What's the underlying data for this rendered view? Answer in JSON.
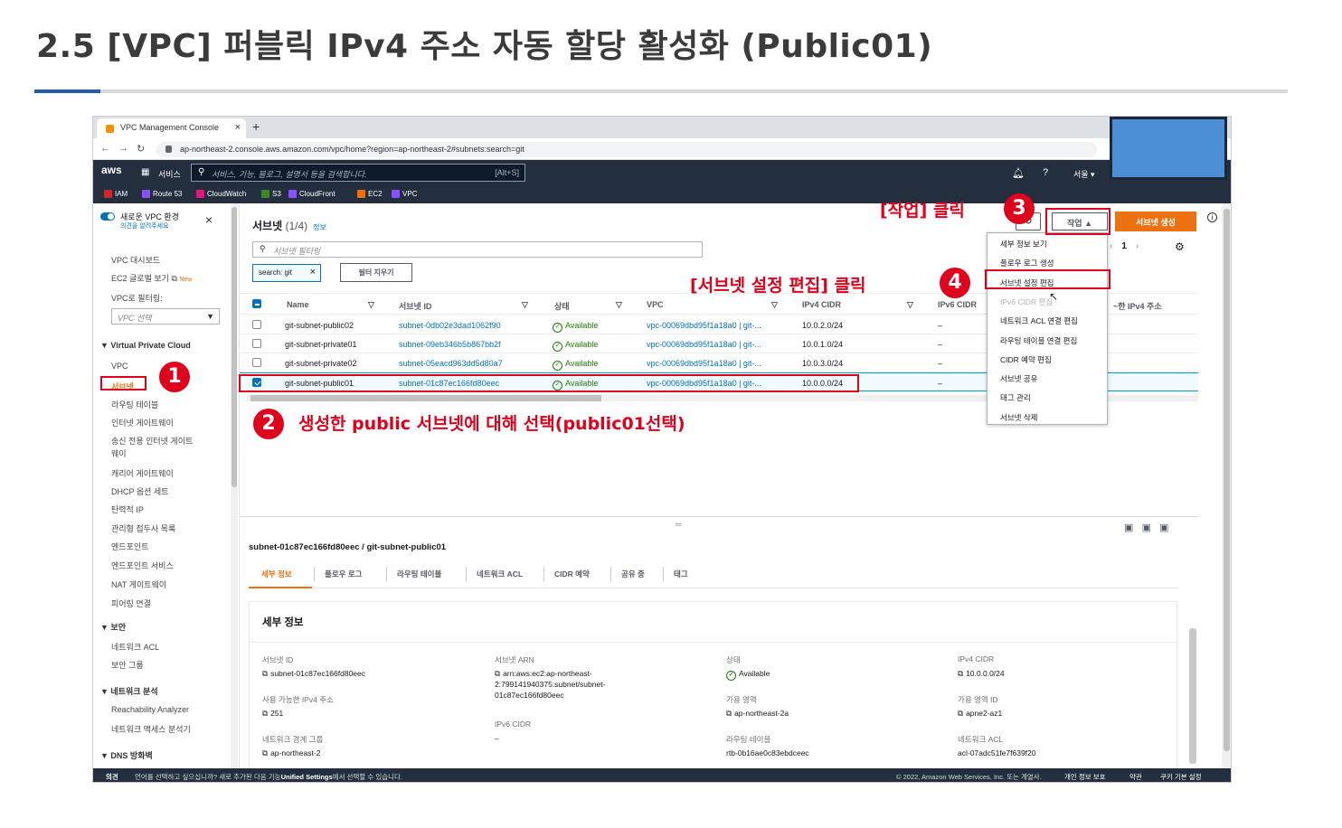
{
  "slide": {
    "title": "2.5 [VPC] 퍼블릭 IPv4 주소 자동 할당 활성화 (Public01)"
  },
  "browser": {
    "tab_title": "VPC Management Console",
    "url": "ap-northeast-2.console.aws.amazon.com/vpc/home?region=ap-northeast-2#subnets:search=git"
  },
  "awsbar": {
    "logo": "aws",
    "services": "서비스",
    "search_placeholder": "서비스, 기능, 블로그, 설명서 등을 검색합니다.",
    "search_shortcut": "[Alt+S]",
    "region": "서울 ▾",
    "bookmarks": [
      {
        "label": "IAM",
        "color": "#d6242d"
      },
      {
        "label": "Route 53",
        "color": "#8c4fff"
      },
      {
        "label": "CloudWatch",
        "color": "#e7157b"
      },
      {
        "label": "S3",
        "color": "#3f8624"
      },
      {
        "label": "CloudFront",
        "color": "#8c4fff"
      },
      {
        "label": "EC2",
        "color": "#ed7100"
      },
      {
        "label": "VPC",
        "color": "#8c4fff"
      }
    ]
  },
  "sidebar": {
    "new_vpc": "새로운 VPC 환경",
    "feedback": "의견을 알려주세요",
    "dashboard": "VPC 대시보드",
    "ec2_global": "EC2 글로벌 보기",
    "new_badge": "New",
    "filter_label": "VPC로 필터링:",
    "vpc_select": "VPC 선택",
    "section_vpc": "Virtual Private Cloud",
    "vpc_items": [
      "VPC",
      "서브넷",
      "라우팅 테이블",
      "인터넷 게이트웨이",
      "송신 전용 인터넷 게이트",
      "웨이",
      "캐리어 게이트웨이",
      "DHCP 옵션 세트",
      "탄력적 IP",
      "관리형 접두사 목록",
      "엔드포인트",
      "엔드포인트 서비스",
      "NAT 게이트웨이",
      "피어링 연결"
    ],
    "section_security": "보안",
    "security_items": [
      "네트워크 ACL",
      "보안 그룹"
    ],
    "section_analysis": "네트워크 분석",
    "analysis_items": [
      "Reachability Analyzer",
      "네트워크 액세스 분석기"
    ],
    "section_dns": "DNS 방화벽"
  },
  "main": {
    "heading": "서브넷",
    "count": "(1/4)",
    "info": "정보",
    "filter_placeholder": "서브넷 필터링",
    "token": "search: git",
    "clear_filter": "필터 지우기",
    "actions": "작업 ▲",
    "create": "서브넷 생성",
    "page": "1",
    "columns": [
      "Name",
      "서브넷 ID",
      "상태",
      "VPC",
      "IPv4 CIDR",
      "IPv6 CIDR",
      "~한 IPv4 주소"
    ],
    "rows": [
      {
        "name": "git-subnet-public02",
        "id": "subnet-0db02e3dad1062f90",
        "state": "Available",
        "vpc": "vpc-00069dbd95f1a18a0 | git-...",
        "cidr": "10.0.2.0/24",
        "ipv6": "–"
      },
      {
        "name": "git-subnet-private01",
        "id": "subnet-09eb346b5b867bb2f",
        "state": "Available",
        "vpc": "vpc-00069dbd95f1a18a0 | git-...",
        "cidr": "10.0.1.0/24",
        "ipv6": "–"
      },
      {
        "name": "git-subnet-private02",
        "id": "subnet-05eacd963dd5d80a7",
        "state": "Available",
        "vpc": "vpc-00069dbd95f1a18a0 | git-...",
        "cidr": "10.0.3.0/24",
        "ipv6": "–"
      },
      {
        "name": "git-subnet-public01",
        "id": "subnet-01c87ec166fd80eec",
        "state": "Available",
        "vpc": "vpc-00069dbd95f1a18a0 | git-...",
        "cidr": "10.0.0.0/24",
        "ipv6": "–"
      }
    ],
    "dropdown": [
      "세부 정보 보기",
      "플로우 로그 생성",
      "서브넷 설정 편집",
      "IPv6 CIDR 편집",
      "네트워크 ACL 연결 편집",
      "라우팅 테이블 연결 편집",
      "CIDR 예약 편집",
      "서브넷 공유",
      "태그 관리",
      "서브넷 삭제"
    ]
  },
  "detail": {
    "subnet_title": "subnet-01c87ec166fd80eec / git-subnet-public01",
    "tabs": [
      "세부 정보",
      "플로우 로그",
      "라우팅 테이블",
      "네트워크 ACL",
      "CIDR 예약",
      "공유 중",
      "태그"
    ],
    "section": "세부 정보",
    "fields": {
      "subnet_id_label": "서브넷 ID",
      "subnet_id": "subnet-01c87ec166fd80eec",
      "arn_label": "서브넷 ARN",
      "arn_1": "arn:aws:ec2:ap-northeast-",
      "arn_2": "2:799141940375:subnet/subnet-",
      "arn_3": "01c87ec166fd80eec",
      "state_label": "상태",
      "state": "Available",
      "ipv4cidr_label": "IPv4 CIDR",
      "ipv4cidr": "10.0.0.0/24",
      "avail_ip_label": "사용 가능한 IPv4 주소",
      "avail_ip": "251",
      "ipv6_label": "IPv6 CIDR",
      "ipv6": "–",
      "az_label": "가용 영역",
      "az": "ap-northeast-2a",
      "azid_label": "가용 영역 ID",
      "azid": "apne2-az1",
      "border_label": "네트워크 경계 그룹",
      "border": "ap-northeast-2",
      "rt_label": "라우팅 테이블",
      "rt": "rtb-0b16ae0c83ebdceec",
      "acl_label": "네트워크 ACL",
      "acl": "acl-07adc51fe7f639f20"
    }
  },
  "footer": {
    "feedback": "의견",
    "lang": "언어를 선택하고 싶으십니까? 새로 추가된 다음 기능",
    "unified": "Unified Settings",
    "lang2": "에서 선택할 수 있습니다.",
    "copyright": "© 2022, Amazon Web Services, Inc. 또는 계열사.",
    "privacy": "개인 정보 보호",
    "terms": "약관",
    "cookies": "쿠키 기본 설정"
  },
  "annotations": {
    "n1": "1",
    "n2": "2",
    "n3": "3",
    "n4": "4",
    "a2": "생성한 public 서브넷에 대해 선택(public01선택)",
    "a3": "[작업] 클릭",
    "a4": "[서브넷 설정 편집] 클릭"
  }
}
